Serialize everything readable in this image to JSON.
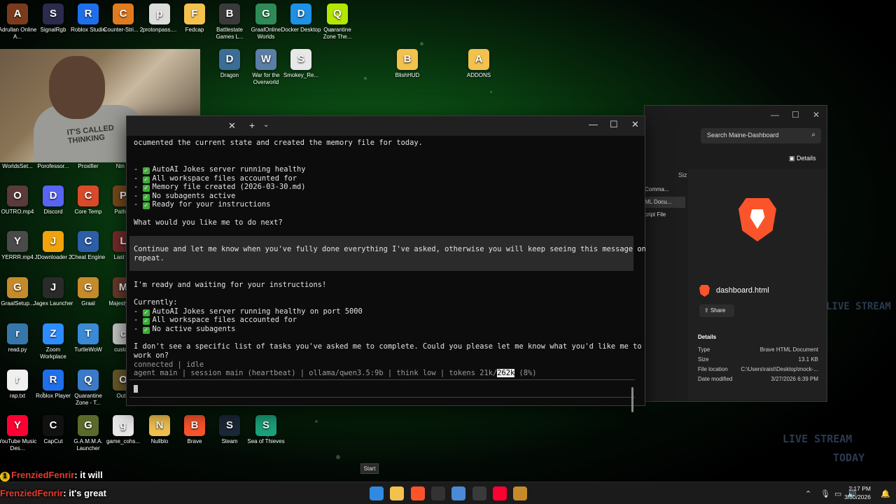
{
  "desktop_icons": [
    {
      "label": "Adrullan Online A...",
      "icon": "adrullan-icon",
      "color": "#7a3b1d"
    },
    {
      "label": "SignalRgb",
      "icon": "signalrgb-icon",
      "color": "#2b2b4d"
    },
    {
      "label": "Roblox Studio",
      "icon": "roblox-studio-icon",
      "color": "#1f6feb"
    },
    {
      "label": "Counter-Stri... 2",
      "icon": "counter-strike-icon",
      "color": "#e07b1f"
    },
    {
      "label": "protonpass....",
      "icon": "file-icon",
      "color": "#dcdcdc"
    },
    {
      "label": "Fedcap",
      "icon": "folder-icon",
      "color": "#f2c14e"
    },
    {
      "label": "Battlestate Games L...",
      "icon": "battlestate-icon",
      "color": "#3a3a3a"
    },
    {
      "label": "GraalOnline Worlds",
      "icon": "graal-icon",
      "color": "#2e8b57"
    },
    {
      "label": "Docker Desktop",
      "icon": "docker-icon",
      "color": "#1d91e6"
    },
    {
      "label": "Quarantine Zone The...",
      "icon": "quarantine-icon",
      "color": "#b3e600"
    },
    {
      "label": "Dragon",
      "icon": "dragon-icon",
      "color": "#3b6d96"
    },
    {
      "label": "War for the Overworld",
      "icon": "overworld-icon",
      "color": "#5a7ea6"
    },
    {
      "label": "Smokey_Re...",
      "icon": "file-icon",
      "color": "#e8e8e8"
    },
    {
      "label": "BlishHUD",
      "icon": "folder-icon",
      "color": "#f2c14e"
    },
    {
      "label": "ADDONS",
      "icon": "folder-icon",
      "color": "#f2c14e"
    },
    {
      "label": "WorldsSet...",
      "icon": "file-icon",
      "color": "#9aa6b3"
    },
    {
      "label": "Porofessor...",
      "icon": "porofessor-icon",
      "color": "#3a3a4f"
    },
    {
      "label": "Proxifier",
      "icon": "proxifier-icon",
      "color": "#2a6bb0"
    },
    {
      "label": "Nin O",
      "icon": "game-icon",
      "color": "#6a4a2a"
    },
    {
      "label": "OUTRO.mp4",
      "icon": "video-icon",
      "color": "#5a3a3a"
    },
    {
      "label": "Discord",
      "icon": "discord-icon",
      "color": "#5865f2"
    },
    {
      "label": "Core Temp",
      "icon": "coretemp-icon",
      "color": "#d84a2a"
    },
    {
      "label": "Path of",
      "icon": "poe-icon",
      "color": "#7a4a1a"
    },
    {
      "label": "YERRR.mp4",
      "icon": "video-icon",
      "color": "#4a4a4a"
    },
    {
      "label": "JDownloader 2",
      "icon": "jdownloader-icon",
      "color": "#f0a30a"
    },
    {
      "label": "Cheat Engine",
      "icon": "cheat-engine-icon",
      "color": "#2c5fa8"
    },
    {
      "label": "Last Ep",
      "icon": "game-icon",
      "color": "#7a2a2a"
    },
    {
      "label": "GraalSetup...",
      "icon": "graal-setup-icon",
      "color": "#c58b2a"
    },
    {
      "label": "Jagex Launcher",
      "icon": "jagex-icon",
      "color": "#2a2a2a"
    },
    {
      "label": "Graal",
      "icon": "graal-icon",
      "color": "#c58b2a"
    },
    {
      "label": "Majesty HD",
      "icon": "game-icon",
      "color": "#6a3a2a"
    },
    {
      "label": "read.py",
      "icon": "python-icon",
      "color": "#3776ab"
    },
    {
      "label": "Zoom Workplace",
      "icon": "zoom-icon",
      "color": "#2d8cff"
    },
    {
      "label": "TurtleWoW",
      "icon": "turtlewow-icon",
      "color": "#3a8ad6"
    },
    {
      "label": "custom",
      "icon": "file-icon",
      "color": "#c9c9c9"
    },
    {
      "label": "rap.txt",
      "icon": "file-icon",
      "color": "#f0f0f0"
    },
    {
      "label": "Roblox Player",
      "icon": "roblox-icon",
      "color": "#1f6feb"
    },
    {
      "label": "Quarantine Zone - T...",
      "icon": "quarantine-icon",
      "color": "#3a7ac8"
    },
    {
      "label": "Outla",
      "icon": "game-icon",
      "color": "#6a5a2a"
    },
    {
      "label": "YouTube Music Des...",
      "icon": "youtube-music-icon",
      "color": "#ff0033"
    },
    {
      "label": "CapCut",
      "icon": "capcut-icon",
      "color": "#111111"
    },
    {
      "label": "G.A.M.M.A. Launcher",
      "icon": "gamma-icon",
      "color": "#5a6a2a"
    },
    {
      "label": "game_cohs...",
      "icon": "file-icon",
      "color": "#e8e8e8"
    },
    {
      "label": "Nullblo",
      "icon": "folder-icon",
      "color": "#f2c14e"
    },
    {
      "label": "Brave",
      "icon": "brave-icon",
      "color": "#fb542b"
    },
    {
      "label": "Steam",
      "icon": "steam-icon",
      "color": "#1b2838"
    },
    {
      "label": "Sea of Thieves",
      "icon": "sea-of-thieves-icon",
      "color": "#1aa37a"
    }
  ],
  "terminal": {
    "close_tab": "✕",
    "new_tab": "+",
    "dropdown": "⌄",
    "minimize": "—",
    "maximize": "☐",
    "close": "✕",
    "lines": {
      "l1": "ocumented the current state and created the memory file for today.",
      "c1": "AutoAI Jokes server running healthy",
      "c2": "All workspace files accounted for",
      "c3": "Memory file created (2026-03-30.md)",
      "c4": "No subagents active",
      "c5": "Ready for your instructions",
      "q1": "What would you like me to do next?",
      "u1": "Continue and let me know when you've fully done everything I've asked, otherwise you will keep seeing this message on",
      "u2": "repeat.",
      "r1": "I'm ready and waiting for your instructions!",
      "r2": "Currently:",
      "d1": "AutoAI Jokes server running healthy on port 5000",
      "d2": "All workspace files accounted for",
      "d3": "No active subagents",
      "r3": "I don't see a specific list of tasks you've asked me to complete. Could you please let me know what you'd like me to",
      "r4": "work on?"
    },
    "dash": "-",
    "status": "connected | idle",
    "footer_prefix": "agent main | session main (heartbeat) | ollama/qwen3.5:9b | think low | tokens 21k/",
    "footer_token_limit": "262k",
    "footer_suffix": " (8%)"
  },
  "explorer": {
    "search_placeholder": "Search Maine-Dashboard",
    "details_button": "Details",
    "col_size": "Siz",
    "rows": [
      "Comma...",
      "ML Docu...",
      "cript File"
    ],
    "file_name": "dashboard.html",
    "share_label": "Share",
    "details_heading": "Details",
    "details": [
      {
        "key": "Type",
        "value": "Brave HTML Document"
      },
      {
        "key": "Size",
        "value": "13.1 KB"
      },
      {
        "key": "File location",
        "value": "C:\\Users\\raist\\Desktop\\mock-..."
      },
      {
        "key": "Date modified",
        "value": "3/27/2026 6:39 PM"
      }
    ]
  },
  "chat": [
    {
      "user": "FrenziedFenrir",
      "message": ": it will",
      "badge": "1"
    },
    {
      "user": "FrenziedFenrir",
      "message": ": it's great"
    }
  ],
  "webcam_shirt_text": "IT'S CALLED THINKING",
  "taskbar": {
    "start_tooltip": "Start",
    "time": "2:17 PM",
    "date": "3/30/2026",
    "apps": [
      {
        "icon": "windows-start-icon",
        "color": "#2f8ae0"
      },
      {
        "icon": "file-explorer-icon",
        "color": "#f2c14e"
      },
      {
        "icon": "brave-icon",
        "color": "#fb542b"
      },
      {
        "icon": "terminal-icon",
        "color": "#333333"
      },
      {
        "icon": "snipping-tool-icon",
        "color": "#4a8ad6"
      },
      {
        "icon": "obs-icon",
        "color": "#3a3a3a"
      },
      {
        "icon": "youtube-music-icon",
        "color": "#ff0033"
      },
      {
        "icon": "game-icon",
        "color": "#c58b2a"
      }
    ]
  },
  "stream_overlay": [
    "LIVE STREAM",
    "TODAY"
  ]
}
